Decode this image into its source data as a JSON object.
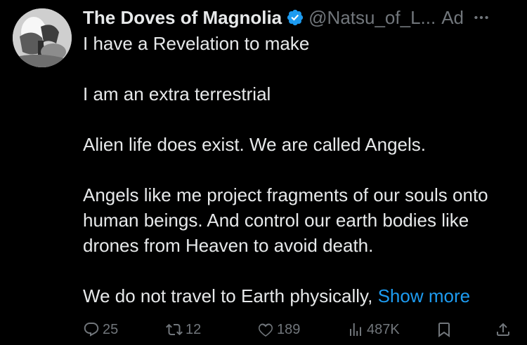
{
  "tweet": {
    "display_name": "The Doves of Magnolia",
    "handle": "@Natsu_of_L...",
    "ad_label": "Ad",
    "paragraphs": [
      "I have a Revelation to make",
      "I am an extra terrestrial",
      "Alien life does exist. We are called Angels.",
      "Angels like me project fragments of our souls onto human beings. And control our earth bodies like drones from Heaven to avoid death.",
      "We do not travel to Earth physically,"
    ],
    "show_more": "Show more"
  },
  "actions": {
    "replies": "25",
    "reposts": "12",
    "likes": "189",
    "views": "487K"
  },
  "colors": {
    "background": "#000000",
    "text": "#e7e9ea",
    "muted": "#71767b",
    "accent": "#1d9bf0"
  },
  "icons": [
    "verified-badge-icon",
    "more-icon",
    "reply-icon",
    "repost-icon",
    "like-icon",
    "views-icon",
    "bookmark-icon",
    "share-icon"
  ]
}
